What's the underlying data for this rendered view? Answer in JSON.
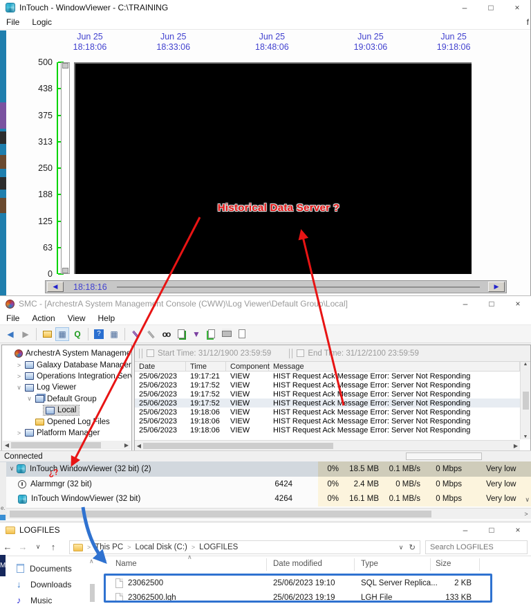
{
  "colors": {
    "ann_red": "#e81414",
    "ann_blue": "#2f72d0",
    "axis_green": "#00d400",
    "label_blue": "#4242cf",
    "sel_row": "#e7ecf2",
    "tm_sel": "#d2d8de",
    "heat": "#fcf4dd"
  },
  "window_controls": {
    "minimize": "–",
    "maximize": "□",
    "close": "×"
  },
  "intouch": {
    "title": "InTouch - WindowViewer - C:\\TRAINING",
    "menu": [
      "File",
      "Logic"
    ],
    "menu_overflow_char": "f",
    "trend": {
      "x_labels": [
        {
          "date": "Jun 25",
          "time": "18:18:06"
        },
        {
          "date": "Jun 25",
          "time": "18:33:06"
        },
        {
          "date": "Jun 25",
          "time": "18:48:06"
        },
        {
          "date": "Jun 25",
          "time": "19:03:06"
        },
        {
          "date": "Jun 25",
          "time": "19:18:06"
        }
      ],
      "y_ticks": [
        "500",
        "438",
        "375",
        "313",
        "250",
        "188",
        "125",
        "63",
        "0"
      ],
      "scroll_time": "18:18:16"
    }
  },
  "smc": {
    "title": "SMC - [ArchestrA System Management Console (CWW)\\Log Viewer\\Default Group\\Local]",
    "menu": [
      "File",
      "Action",
      "View",
      "Help"
    ],
    "toolbar_icons": [
      "back-icon",
      "forward-icon",
      "folder-up-icon",
      "show-console-tree-icon",
      "refresh-icon",
      "help-icon",
      "console-window-icon",
      "mark-icon",
      "mark-gray-icon",
      "find-icon",
      "message-page-icon",
      "filter-icon",
      "export-icon",
      "print-icon",
      "print-preview-icon"
    ],
    "filters": {
      "start_label": "Start Time:",
      "start_value": "31/12/1900   23:59:59",
      "end_label": "End Time:",
      "end_value": "31/12/2100   23:59:59"
    },
    "tree": [
      {
        "label": "ArchestrA System Management Co",
        "indent": 0,
        "expander": "",
        "icon": "swirl",
        "selected": false
      },
      {
        "label": "Galaxy Database Manager",
        "indent": 1,
        "expander": ">",
        "icon": "server",
        "selected": false
      },
      {
        "label": "Operations Integration Server M",
        "indent": 1,
        "expander": ">",
        "icon": "server",
        "selected": false
      },
      {
        "label": "Log Viewer",
        "indent": 1,
        "expander": "v",
        "icon": "monitor",
        "selected": false
      },
      {
        "label": "Default Group",
        "indent": 2,
        "expander": "v",
        "icon": "group",
        "selected": false
      },
      {
        "label": "Local",
        "indent": 3,
        "expander": "",
        "icon": "monitor",
        "selected": true
      },
      {
        "label": "Opened Log Files",
        "indent": 2,
        "expander": "",
        "icon": "folder",
        "selected": false
      },
      {
        "label": "Platform Manager",
        "indent": 1,
        "expander": ">",
        "icon": "monitor",
        "selected": false
      }
    ],
    "log": {
      "columns": [
        "Date",
        "Time",
        "Component",
        "Message"
      ],
      "selected_index": 3,
      "rows": [
        [
          "25/06/2023",
          "19:17:21",
          "VIEW",
          "HIST Request Ack Message Error: Server Not Responding"
        ],
        [
          "25/06/2023",
          "19:17:52",
          "VIEW",
          "HIST Request Ack Message Error: Server Not Responding"
        ],
        [
          "25/06/2023",
          "19:17:52",
          "VIEW",
          "HIST Request Ack Message Error: Server Not Responding"
        ],
        [
          "25/06/2023",
          "19:17:52",
          "VIEW",
          "HIST Request Ack Message Error: Server Not Responding"
        ],
        [
          "25/06/2023",
          "19:18:06",
          "VIEW",
          "HIST Request Ack Message Error: Server Not Responding"
        ],
        [
          "25/06/2023",
          "19:18:06",
          "VIEW",
          "HIST Request Ack Message Error: Server Not Responding"
        ],
        [
          "25/06/2023",
          "19:18:06",
          "VIEW",
          "HIST Request Ack Message Error: Server Not Responding"
        ]
      ]
    },
    "status": "Connected"
  },
  "taskmgr": {
    "rows": [
      {
        "name": "InTouch WindowViewer (32 bit) (2)",
        "pid": "",
        "cpu": "0%",
        "mem": "18.5 MB",
        "disk": "0.1 MB/s",
        "net": "0 Mbps",
        "power": "Very low",
        "icon": "intouch",
        "expander": "v",
        "selected": true,
        "child": false
      },
      {
        "name": "Alarmmgr (32 bit)",
        "pid": "6424",
        "cpu": "0%",
        "mem": "2.4 MB",
        "disk": "0 MB/s",
        "net": "0 Mbps",
        "power": "Very low",
        "icon": "alarm",
        "expander": "",
        "selected": false,
        "child": true
      },
      {
        "name": "InTouch WindowViewer (32 bit)",
        "pid": "4264",
        "cpu": "0%",
        "mem": "16.1 MB",
        "disk": "0.1 MB/s",
        "net": "0 Mbps",
        "power": "Very low",
        "icon": "intouch",
        "expander": "",
        "selected": false,
        "child": true
      }
    ]
  },
  "explorer": {
    "title": "LOGFILES",
    "breadcrumb": [
      "This PC",
      "Local Disk (C:)",
      "LOGFILES"
    ],
    "search_placeholder": "Search LOGFILES",
    "sidebar": [
      "Documents",
      "Downloads",
      "Music"
    ],
    "columns": [
      "Name",
      "Date modified",
      "Type",
      "Size"
    ],
    "files": [
      {
        "name": "23062500",
        "modified": "25/06/2023 19:10",
        "type": "SQL Server Replica...",
        "size": "2 KB"
      },
      {
        "name": "23062500.lgh",
        "modified": "25/06/2023 19:19",
        "type": "LGH File",
        "size": "133 KB"
      }
    ]
  },
  "annotations": {
    "label": "Historical Data Server ?",
    "doodle": "¿?"
  },
  "fragments": {
    "left_edge_m": "M",
    "left_edge_e": "e."
  }
}
